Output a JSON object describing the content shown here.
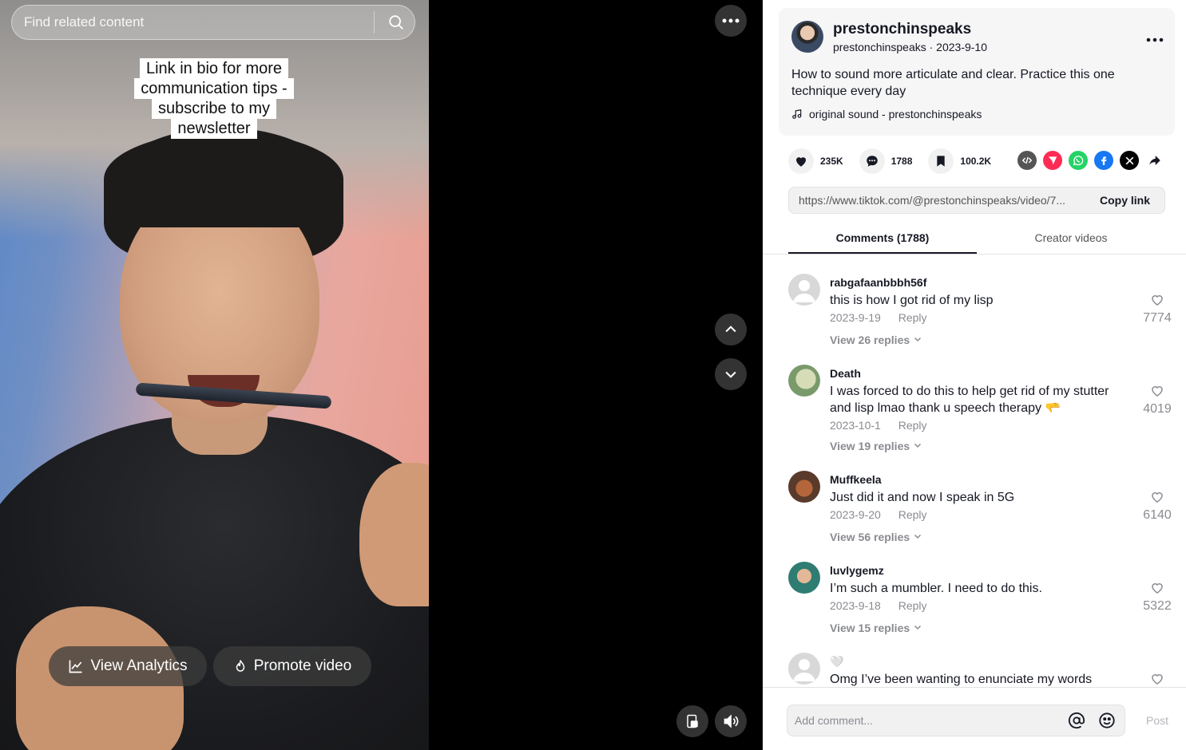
{
  "search": {
    "placeholder": "Find related content"
  },
  "video": {
    "caption_lines": [
      "Link in bio for more",
      "communication tips -",
      "subscribe to my",
      "newsletter"
    ],
    "view_analytics_label": "View Analytics",
    "promote_video_label": "Promote video",
    "more_icon": "more-horizontal-icon",
    "nav_up_icon": "chevron-up-icon",
    "nav_down_icon": "chevron-down-icon",
    "miniplayer_icon": "floating-player-icon",
    "volume_icon": "volume-icon"
  },
  "post": {
    "author": "prestonchinspeaks",
    "author_handle": "prestonchinspeaks",
    "date": "2023-9-10",
    "sub_line": "prestonchinspeaks · 2023-9-10",
    "description": "How to sound more articulate and clear. Practice this one technique every day",
    "sound": "original sound - prestonchinspeaks",
    "likes": "235K",
    "comments": "1788",
    "saves": "100.2K",
    "link": "https://www.tiktok.com/@prestonchinspeaks/video/7...",
    "copy_link_label": "Copy link"
  },
  "tabs": [
    {
      "label": "Comments (1788)",
      "active": true
    },
    {
      "label": "Creator videos",
      "active": false
    }
  ],
  "comments": [
    {
      "user": "rabgafaanbbbh56f",
      "text": "this is how I got rid of my lisp",
      "date": "2023-9-19",
      "reply_label": "Reply",
      "replies": "View 26 replies",
      "likes": "7774"
    },
    {
      "user": "Death",
      "text": "I was forced to do this to help get rid of my stutter and lisp lmao thank u speech therapy 🫳",
      "date": "2023-10-1",
      "reply_label": "Reply",
      "replies": "View 19 replies",
      "likes": "4019"
    },
    {
      "user": "Muffkeela",
      "text": "Just did it and now I speak in 5G",
      "date": "2023-9-20",
      "reply_label": "Reply",
      "replies": "View 56 replies",
      "likes": "6140"
    },
    {
      "user": "luvlygemz",
      "text": "I’m such a mumbler. I need to do this.",
      "date": "2023-9-18",
      "reply_label": "Reply",
      "replies": "View 15 replies",
      "likes": "5322"
    },
    {
      "user": "🤍",
      "text": "Omg I’ve been wanting to enunciate my words",
      "date": "",
      "reply_label": "",
      "replies": "",
      "likes": ""
    }
  ],
  "comment_box": {
    "placeholder": "Add comment...",
    "post_label": "Post"
  },
  "colors": {
    "accent": "#fe2c55",
    "text": "#161823",
    "muted": "#8a8b91"
  }
}
